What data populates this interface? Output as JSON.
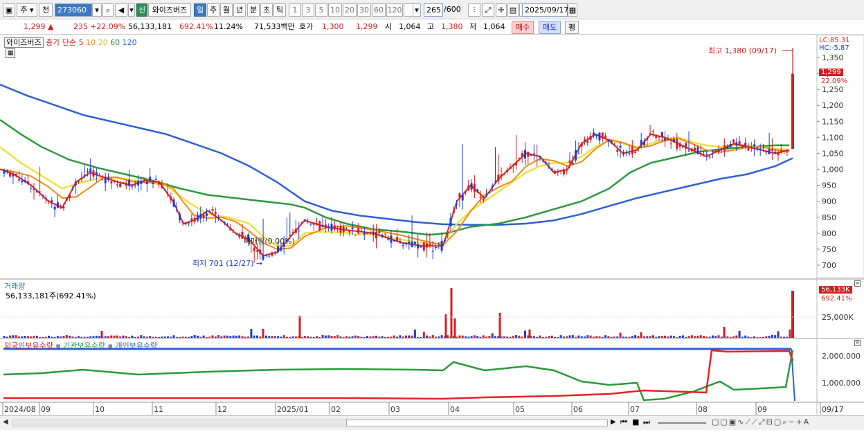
{
  "toolbar": {
    "period": "주",
    "mode": "전",
    "code": "273060",
    "stock_name": "와이즈버즈",
    "badge": "신",
    "tabs": [
      "일",
      "주",
      "월",
      "년",
      "분",
      "초",
      "틱"
    ],
    "active_tab": "일",
    "intervals": [
      "1",
      "3",
      "5",
      "10",
      "20",
      "30",
      "60",
      "120"
    ],
    "count": "265",
    "count_total": "/600",
    "date": "2025/09/17"
  },
  "quote": {
    "price": "1,299",
    "change": "235",
    "change_pct": "+22.09%",
    "volume": "56,133,181",
    "vol_ratio": "692.41%",
    "turnover": "11.24%",
    "amount": "71,533백만",
    "bid_label": "호가",
    "bid": "1,300",
    "ask": "1,299",
    "open_label": "시",
    "open": "1,064",
    "high_label": "고",
    "high": "1,380",
    "low_label": "저",
    "low": "1,064",
    "buy": "매수",
    "sell": "매도",
    "avg": "평"
  },
  "colors": {
    "ma5": "#e82020",
    "ma10": "#ef8a14",
    "ma20": "#f0e040",
    "ma60": "#2a9a3a",
    "ma120": "#2d5fd6",
    "up": "#d21e1e",
    "down": "#1e3cd2"
  },
  "legend": {
    "name": "와이즈버즈",
    "ma_label": "종가 단순",
    "ma_periods": [
      "5",
      "10",
      "20",
      "60",
      "120"
    ],
    "volume_title": "거래량",
    "volume_value": "56,133,181주(692.41%)",
    "holdings": [
      "외국인보유수량",
      "기관보유수량",
      "개인보유수량"
    ]
  },
  "annotations": {
    "high": "최고 1,380 (09/17)",
    "low": "최저 701 (12/27)",
    "trade_note": "매매량(0.00%)",
    "lc": "LC:85.31",
    "hc": "HC:-5.87",
    "price_tag": "1,299",
    "pct_tag": "22.09%",
    "vol_tag": "56,133K",
    "vol_pct_tag": "692.41%"
  },
  "chart_data": {
    "type": "candlestick",
    "price_axis": [
      "1,350",
      "1,300",
      "1,250",
      "1,200",
      "1,150",
      "1,100",
      "1,050",
      "1,000",
      "950",
      "900",
      "850",
      "800",
      "750",
      "700"
    ],
    "volume_axis": [
      "25,000K"
    ],
    "holdings_axis": [
      "2,000,000",
      "1,000,000"
    ],
    "x_labels": [
      "2024/08",
      "09",
      "10",
      "11",
      "12",
      "2025/01",
      "02",
      "03",
      "04",
      "05",
      "06",
      "07",
      "08",
      "09",
      "09/17"
    ],
    "ma_close": [
      [
        0,
        1000
      ],
      [
        20,
        985
      ],
      [
        45,
        950
      ],
      [
        70,
        900
      ],
      [
        90,
        880
      ],
      [
        110,
        960
      ],
      [
        130,
        990
      ],
      [
        150,
        975
      ],
      [
        170,
        960
      ],
      [
        190,
        950
      ],
      [
        210,
        965
      ],
      [
        230,
        960
      ],
      [
        250,
        900
      ],
      [
        265,
        830
      ],
      [
        280,
        840
      ],
      [
        300,
        870
      ],
      [
        320,
        840
      ],
      [
        340,
        800
      ],
      [
        360,
        780
      ],
      [
        380,
        730
      ],
      [
        400,
        740
      ],
      [
        420,
        790
      ],
      [
        440,
        840
      ],
      [
        470,
        820
      ],
      [
        500,
        810
      ],
      [
        540,
        800
      ],
      [
        580,
        770
      ],
      [
        610,
        760
      ],
      [
        640,
        760
      ],
      [
        660,
        900
      ],
      [
        680,
        950
      ],
      [
        700,
        910
      ],
      [
        720,
        970
      ],
      [
        740,
        1010
      ],
      [
        760,
        1050
      ],
      [
        780,
        1040
      ],
      [
        800,
        990
      ],
      [
        820,
        1000
      ],
      [
        840,
        1080
      ],
      [
        860,
        1110
      ],
      [
        880,
        1090
      ],
      [
        900,
        1050
      ],
      [
        920,
        1060
      ],
      [
        940,
        1110
      ],
      [
        960,
        1100
      ],
      [
        980,
        1080
      ],
      [
        1000,
        1060
      ],
      [
        1020,
        1040
      ],
      [
        1040,
        1060
      ],
      [
        1060,
        1080
      ],
      [
        1080,
        1070
      ],
      [
        1100,
        1060
      ],
      [
        1120,
        1050
      ],
      [
        1140,
        1060
      ]
    ],
    "ma20_line": [
      [
        0,
        1070
      ],
      [
        30,
        1020
      ],
      [
        60,
        980
      ],
      [
        90,
        940
      ],
      [
        120,
        960
      ],
      [
        150,
        975
      ],
      [
        180,
        970
      ],
      [
        210,
        960
      ],
      [
        240,
        950
      ],
      [
        270,
        900
      ],
      [
        300,
        860
      ],
      [
        330,
        850
      ],
      [
        360,
        830
      ],
      [
        380,
        790
      ],
      [
        400,
        760
      ],
      [
        420,
        760
      ],
      [
        440,
        800
      ],
      [
        470,
        805
      ],
      [
        500,
        800
      ],
      [
        540,
        795
      ],
      [
        580,
        780
      ],
      [
        620,
        765
      ],
      [
        640,
        770
      ],
      [
        660,
        830
      ],
      [
        680,
        870
      ],
      [
        700,
        900
      ],
      [
        720,
        930
      ],
      [
        740,
        960
      ],
      [
        760,
        990
      ],
      [
        780,
        1010
      ],
      [
        800,
        1020
      ],
      [
        820,
        1020
      ],
      [
        840,
        1040
      ],
      [
        860,
        1070
      ],
      [
        880,
        1090
      ],
      [
        900,
        1080
      ],
      [
        920,
        1070
      ],
      [
        940,
        1080
      ],
      [
        960,
        1095
      ],
      [
        980,
        1100
      ],
      [
        1000,
        1085
      ],
      [
        1020,
        1075
      ],
      [
        1040,
        1070
      ],
      [
        1060,
        1075
      ],
      [
        1080,
        1075
      ],
      [
        1100,
        1070
      ],
      [
        1120,
        1065
      ],
      [
        1140,
        1060
      ]
    ],
    "ma60_line": [
      [
        0,
        1155
      ],
      [
        30,
        1110
      ],
      [
        60,
        1070
      ],
      [
        100,
        1030
      ],
      [
        140,
        1005
      ],
      [
        180,
        985
      ],
      [
        220,
        965
      ],
      [
        260,
        940
      ],
      [
        300,
        920
      ],
      [
        340,
        910
      ],
      [
        380,
        900
      ],
      [
        420,
        890
      ],
      [
        440,
        880
      ],
      [
        470,
        850
      ],
      [
        500,
        830
      ],
      [
        540,
        812
      ],
      [
        580,
        805
      ],
      [
        620,
        795
      ],
      [
        645,
        800
      ],
      [
        680,
        820
      ],
      [
        720,
        830
      ],
      [
        760,
        850
      ],
      [
        800,
        875
      ],
      [
        840,
        900
      ],
      [
        880,
        940
      ],
      [
        910,
        990
      ],
      [
        940,
        1020
      ],
      [
        980,
        1040
      ],
      [
        1010,
        1055
      ],
      [
        1050,
        1065
      ],
      [
        1080,
        1070
      ],
      [
        1120,
        1075
      ],
      [
        1140,
        1075
      ]
    ],
    "ma120_line": [
      [
        0,
        1265
      ],
      [
        40,
        1230
      ],
      [
        80,
        1200
      ],
      [
        120,
        1170
      ],
      [
        160,
        1150
      ],
      [
        200,
        1130
      ],
      [
        240,
        1110
      ],
      [
        280,
        1080
      ],
      [
        320,
        1050
      ],
      [
        360,
        1010
      ],
      [
        400,
        960
      ],
      [
        440,
        900
      ],
      [
        480,
        870
      ],
      [
        520,
        855
      ],
      [
        560,
        845
      ],
      [
        600,
        835
      ],
      [
        640,
        828
      ],
      [
        680,
        826
      ],
      [
        720,
        826
      ],
      [
        760,
        830
      ],
      [
        800,
        840
      ],
      [
        840,
        860
      ],
      [
        880,
        885
      ],
      [
        920,
        910
      ],
      [
        960,
        930
      ],
      [
        1000,
        950
      ],
      [
        1040,
        970
      ],
      [
        1080,
        985
      ],
      [
        1120,
        1010
      ],
      [
        1145,
        1035
      ]
    ],
    "candle_close": 1299,
    "candle_high": 1380
  }
}
